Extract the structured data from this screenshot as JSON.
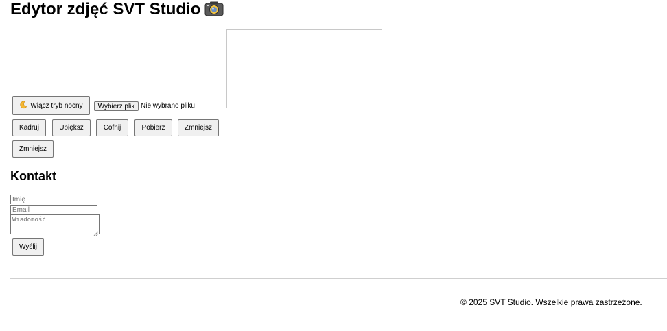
{
  "header": {
    "title": "Edytor zdjęć SVT Studio"
  },
  "toolbar": {
    "night_mode_label": "Włącz tryb nocny",
    "file_button_label": "Wybierz plik",
    "file_status": "Nie wybrano pliku",
    "buttons": [
      "Kadruj",
      "Upiększ",
      "Cofnij",
      "Pobierz",
      "Zmniejsz",
      "Zmniejsz"
    ]
  },
  "contact": {
    "heading": "Kontakt",
    "name_placeholder": "Imię",
    "email_placeholder": "Email",
    "message_placeholder": "Wiadomość",
    "submit_label": "Wyślij"
  },
  "footer": {
    "text": "© 2025 SVT Studio. Wszelkie prawa zastrzeżone."
  }
}
